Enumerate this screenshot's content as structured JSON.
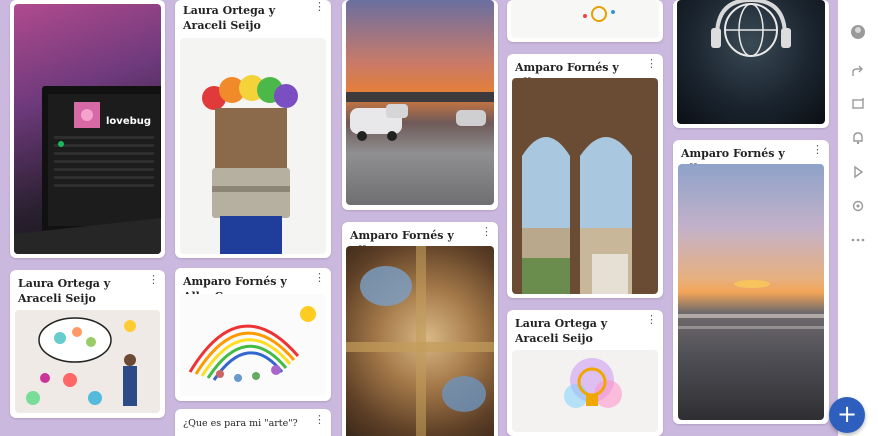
{
  "cards": {
    "c1_laptop": {
      "screen_text": "lovebug"
    },
    "c2_laura_araceli": {
      "title": "Laura Ortega y Araceli Seijo"
    },
    "c3_brush": {
      "title": "Laura Ortega y Araceli Seijo"
    },
    "c4_amparo_alba": {
      "title": "Amparo Fornés y Alba Caro"
    },
    "c5_que_es_arte": {
      "title": "¿Que es para mi \"arte\"?"
    },
    "c6_amparo_alba": {
      "title": "Amparo Fornés y Alba Caro"
    },
    "c7_amparo_alba": {
      "title": "Amparo Fornés y Alba Caro"
    },
    "c8_laura_araceli": {
      "title": "Laura Ortega y Araceli Seijo"
    },
    "c9_amparo_alba": {
      "title": "Amparo Fornés y Alba Caro"
    }
  },
  "menu_glyph": "⋮",
  "fab_label": "+",
  "side_rail": {
    "icons": [
      "avatar-icon",
      "share-icon",
      "remix-icon",
      "bell-icon",
      "play-icon",
      "settings-icon",
      "more-icon"
    ]
  },
  "colors": {
    "board_background": "#cbb8df",
    "fab": "#2f5fbe"
  }
}
